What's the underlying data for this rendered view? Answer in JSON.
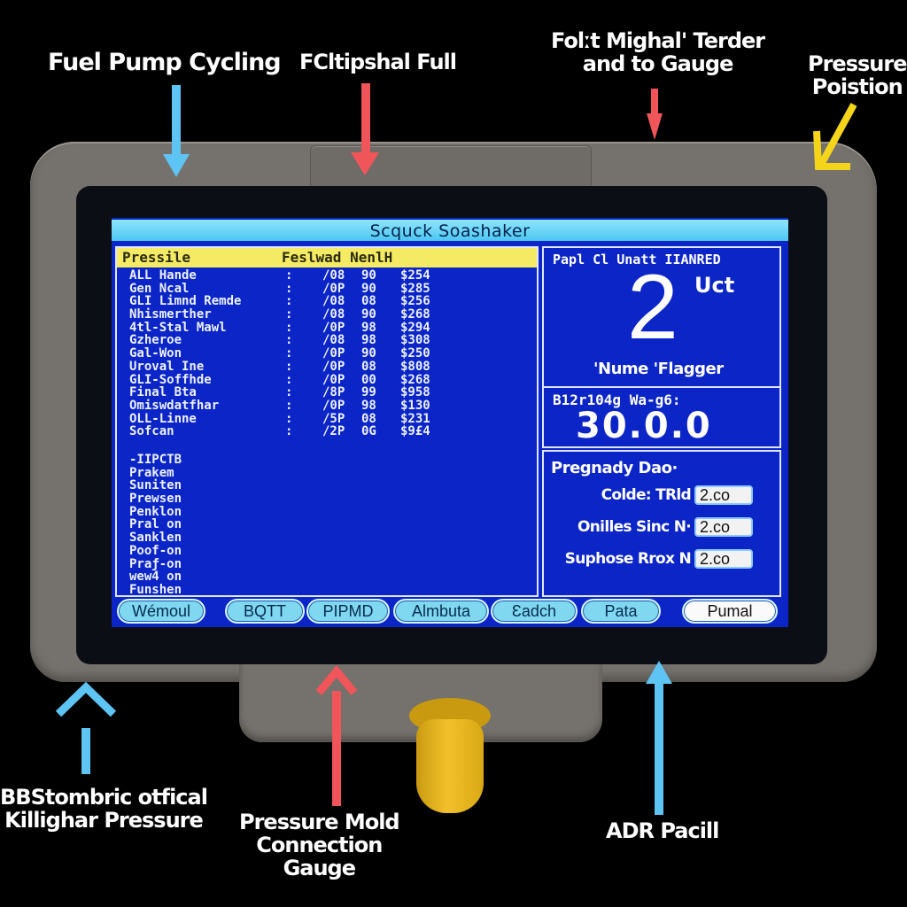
{
  "callouts": {
    "top_left": "Fuel Pump Cycling",
    "top_center": "FCltipshal Full",
    "top_right_line1": "Folːt Mighal' Terder",
    "top_right_line2": "and to Gauge",
    "far_right_line1": "Pressure",
    "far_right_line2": "Poistion",
    "bottom_left_line1": "BBStombric otfical",
    "bottom_left_line2": "Killighar Pressure",
    "bottom_center_line1": "Pressure Mold",
    "bottom_center_line2": "Connection",
    "bottom_center_line3": "Gauge",
    "bottom_right": "ADR Pacill"
  },
  "arrow_colors": {
    "blue": "#5ec4f4",
    "red": "#f0555a",
    "yellow": "#f5d51c"
  },
  "screen": {
    "title": "Scquck Soashaker",
    "left_panel": {
      "header_col1": "Pressile",
      "header_col2": "Feslwad NenlH",
      "rows": [
        {
          "name": "ALL Hande",
          "sep": ":",
          "a": "/08",
          "b": "90",
          "c": "$254"
        },
        {
          "name": "Gen Ncal",
          "sep": ":",
          "a": "/0P",
          "b": "90",
          "c": "$285"
        },
        {
          "name": "GLI Limnd Remde",
          "sep": ":",
          "a": "/08",
          "b": "08",
          "c": "$256"
        },
        {
          "name": "Nhismerther",
          "sep": ":",
          "a": "/08",
          "b": "90",
          "c": "$268"
        },
        {
          "name": "4tl-Stal Mawl",
          "sep": ":",
          "a": "/0P",
          "b": "98",
          "c": "$294"
        },
        {
          "name": "Gzheroe",
          "sep": ":",
          "a": "/08",
          "b": "98",
          "c": "$308"
        },
        {
          "name": "Gal-Won",
          "sep": ":",
          "a": "/0P",
          "b": "90",
          "c": "$250"
        },
        {
          "name": "Uroval Ine",
          "sep": ":",
          "a": "/0P",
          "b": "08",
          "c": "$808"
        },
        {
          "name": "GLI-Soffhde",
          "sep": ":",
          "a": "/0P",
          "b": "00",
          "c": "$268"
        },
        {
          "name": "Final Bta",
          "sep": ":",
          "a": "/8P",
          "b": "99",
          "c": "$958"
        },
        {
          "name": "Omiswdatfhar",
          "sep": ":",
          "a": "/0P",
          "b": "98",
          "c": "$130"
        },
        {
          "name": "OLL-Linne",
          "sep": ":",
          "a": "/5P",
          "b": "08",
          "c": "$231"
        },
        {
          "name": "Sofcan",
          "sep": ":",
          "a": "/2P",
          "b": "0G",
          "c": "$9£4"
        }
      ],
      "subitems": [
        "-IIPCTB",
        "Prakem",
        "Suniten",
        "Prewsen",
        "Penklon",
        "Pral on",
        "Sanklen",
        "Poof-on",
        "Praƒ-on",
        "wew4 on",
        "Funshen"
      ]
    },
    "right_top": {
      "label": "Papl Cl Unatt IIANRED",
      "value": "2",
      "unit": "Uct",
      "caption": "'Nume 'Flagger"
    },
    "right_mid": {
      "label": "B12r104g Wa-g6:",
      "value": "30.0.0"
    },
    "right_bottom": {
      "title": "Pregnady Dao·",
      "fields": [
        {
          "label": "Colde: TRld",
          "value": "2.co"
        },
        {
          "label": "Onilles Sinc N·",
          "value": "2.co"
        },
        {
          "label": "Suphose Rrox N",
          "value": "2.co"
        }
      ]
    },
    "buttons": [
      "Wémoul",
      "BQTT",
      "PIPMD",
      "Almbuta",
      "Ɛadch",
      "Pata",
      "Pumal"
    ]
  }
}
